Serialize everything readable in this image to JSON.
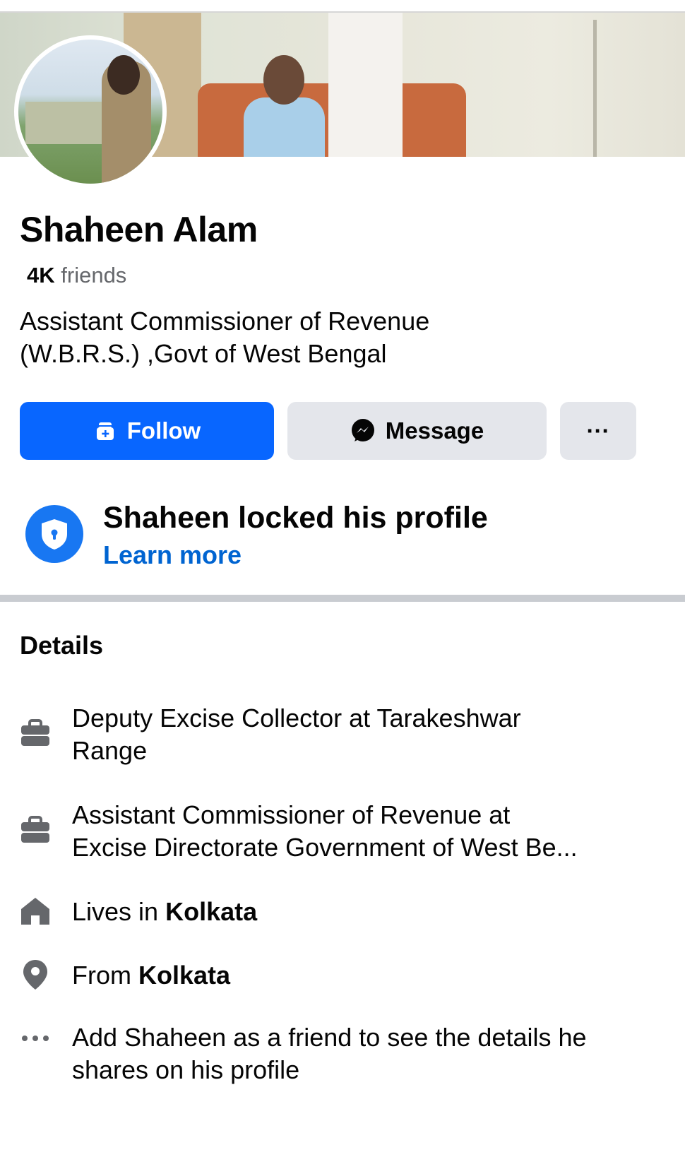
{
  "profile": {
    "name": "Shaheen Alam",
    "friends_count": "4K",
    "friends_label": "friends",
    "bio_line1": "Assistant Commissioner of Revenue",
    "bio_line2": "(W.B.R.S.) ,Govt of West Bengal"
  },
  "actions": {
    "follow_label": "Follow",
    "message_label": "Message",
    "more_label": "···"
  },
  "locked": {
    "title": "Shaheen locked his profile",
    "link": "Learn more"
  },
  "details": {
    "title": "Details",
    "items": [
      {
        "icon": "briefcase-icon",
        "line1": "Deputy Excise Collector at Tarakeshwar",
        "line2": "Range"
      },
      {
        "icon": "briefcase-icon",
        "line1": "Assistant Commissioner of Revenue at",
        "line2": "Excise Directorate Government of West Be..."
      },
      {
        "icon": "home-icon",
        "prefix": "Lives in",
        "value": "Kolkata"
      },
      {
        "icon": "location-pin-icon",
        "prefix": "From",
        "value": "Kolkata"
      },
      {
        "icon": "more-dots-icon",
        "line1": "Add Shaheen as a friend to see the details he",
        "line2": "shares on his profile"
      }
    ]
  },
  "colors": {
    "primary": "#0866ff",
    "link": "#0064d1",
    "secondary_button": "#e4e6eb",
    "muted_text": "#65676b"
  }
}
